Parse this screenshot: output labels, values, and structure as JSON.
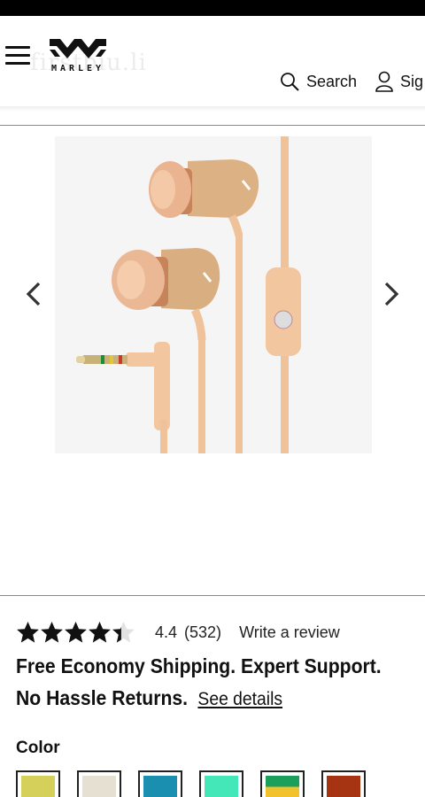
{
  "header": {
    "brand": "MARLEY",
    "watermark": "firstbiu.li",
    "search_label": "Search",
    "signin_label": "Sig"
  },
  "product": {
    "image_alt": "Smile Jamaica wireless earbuds - wood and copper",
    "rating_value": 4.4,
    "rating_display": "4.4",
    "review_count": "(532)",
    "write_review": "Write a review",
    "star_count": 5,
    "stars_filled": 4.4
  },
  "shipping": {
    "text": "Free Economy Shipping. Expert Support. No Hassle Returns.",
    "link": "See details"
  },
  "color": {
    "label": "Color",
    "swatches": [
      {
        "name": "yellow",
        "color": "#d4d05a"
      },
      {
        "name": "cream",
        "color": "#e6e0d2"
      },
      {
        "name": "teal",
        "color": "#1a8fb0"
      },
      {
        "name": "mint",
        "color": "#44e8b8"
      },
      {
        "name": "rasta",
        "color": "#1aa05a"
      },
      {
        "name": "rust",
        "color": "#a63311"
      }
    ]
  },
  "colors": {
    "wood": "#dcb588",
    "copper": "#f0c6a0",
    "text": "#111111"
  }
}
